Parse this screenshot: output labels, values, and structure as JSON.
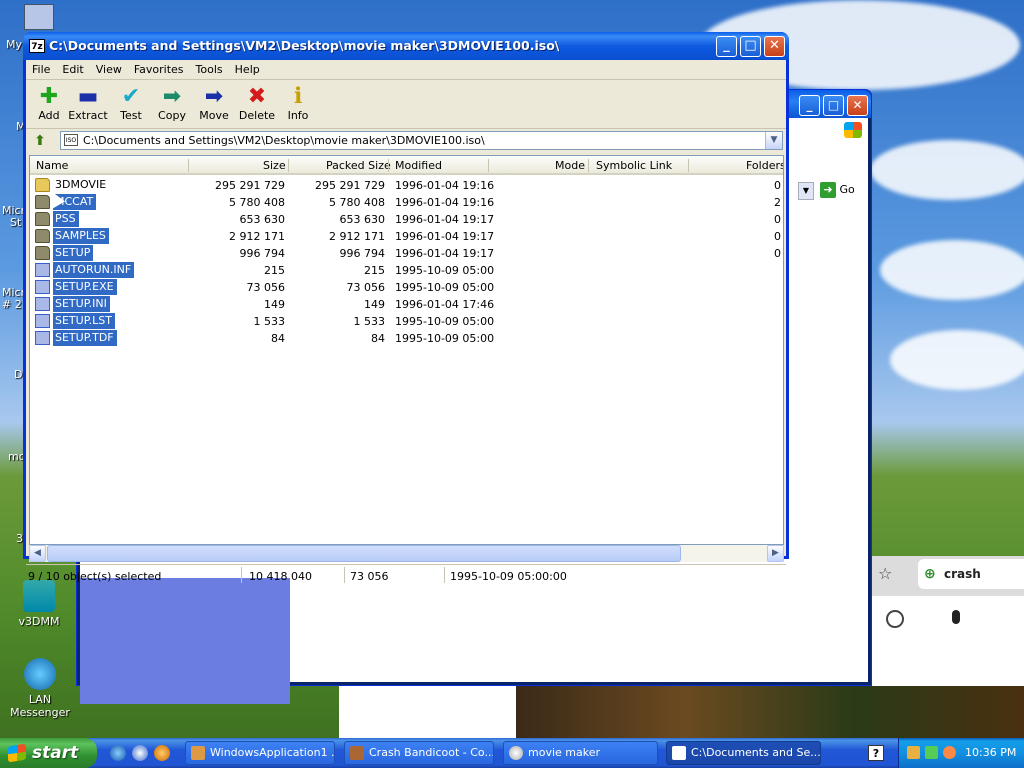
{
  "window": {
    "title": "C:\\Documents and Settings\\VM2\\Desktop\\movie maker\\3DMOVIE100.iso\\",
    "app_icon_text": "7z"
  },
  "menu": [
    "File",
    "Edit",
    "View",
    "Favorites",
    "Tools",
    "Help"
  ],
  "toolbar": [
    {
      "label": "Add",
      "icon": "plus-icon",
      "color": "#1ea51e",
      "glyph": "✚"
    },
    {
      "label": "Extract",
      "icon": "minus-icon",
      "color": "#1a2fa8",
      "glyph": "▬"
    },
    {
      "label": "Test",
      "icon": "check-icon",
      "color": "#19a9c9",
      "glyph": "✔"
    },
    {
      "label": "Copy",
      "icon": "copy-arrow-icon",
      "color": "#1d8a6a",
      "glyph": "➡"
    },
    {
      "label": "Move",
      "icon": "move-arrow-icon",
      "color": "#1a2fa8",
      "glyph": "➡"
    },
    {
      "label": "Delete",
      "icon": "delete-x-icon",
      "color": "#d41a1a",
      "glyph": "✖"
    },
    {
      "label": "Info",
      "icon": "info-icon",
      "color": "#c8a000",
      "glyph": "ℹ"
    }
  ],
  "address": {
    "path": "C:\\Documents and Settings\\VM2\\Desktop\\movie maker\\3DMOVIE100.iso\\",
    "icon_text": "ISO"
  },
  "columns": {
    "name": "Name",
    "size": "Size",
    "packed": "Packed Size",
    "modified": "Modified",
    "mode": "Mode",
    "symlink": "Symbolic Link",
    "folders": "Folders"
  },
  "files": [
    {
      "name": "3DMOVIE",
      "type": "folder",
      "size": "295 291 729",
      "packed": "295 291 729",
      "modified": "1996-01-04 19:16",
      "folders": "0",
      "selected": false
    },
    {
      "name": "MCCAT",
      "type": "folder",
      "size": "5 780 408",
      "packed": "5 780 408",
      "modified": "1996-01-04 19:16",
      "folders": "2",
      "selected": true
    },
    {
      "name": "PSS",
      "type": "folder",
      "size": "653 630",
      "packed": "653 630",
      "modified": "1996-01-04 19:17",
      "folders": "0",
      "selected": true
    },
    {
      "name": "SAMPLES",
      "type": "folder",
      "size": "2 912 171",
      "packed": "2 912 171",
      "modified": "1996-01-04 19:17",
      "folders": "0",
      "selected": true
    },
    {
      "name": "SETUP",
      "type": "folder",
      "size": "996 794",
      "packed": "996 794",
      "modified": "1996-01-04 19:17",
      "folders": "0",
      "selected": true
    },
    {
      "name": "AUTORUN.INF",
      "type": "file",
      "size": "215",
      "packed": "215",
      "modified": "1995-10-09 05:00",
      "folders": "",
      "selected": true
    },
    {
      "name": "SETUP.EXE",
      "type": "file",
      "size": "73 056",
      "packed": "73 056",
      "modified": "1995-10-09 05:00",
      "folders": "",
      "selected": true
    },
    {
      "name": "SETUP.INI",
      "type": "file",
      "size": "149",
      "packed": "149",
      "modified": "1996-01-04 17:46",
      "folders": "",
      "selected": true
    },
    {
      "name": "SETUP.LST",
      "type": "file",
      "size": "1 533",
      "packed": "1 533",
      "modified": "1995-10-09 05:00",
      "folders": "",
      "selected": true
    },
    {
      "name": "SETUP.TDF",
      "type": "file",
      "size": "84",
      "packed": "84",
      "modified": "1995-10-09 05:00",
      "folders": "",
      "selected": true
    }
  ],
  "status": {
    "selection": "9 / 10 object(s) selected",
    "total_size": "10 418 040",
    "item_size": "73 056",
    "item_date": "1995-10-09 05:00:00"
  },
  "desktop_icons": [
    {
      "label": "v3DMM"
    },
    {
      "label": "LAN Messenger"
    }
  ],
  "desktop_partial_labels": [
    "My",
    "M",
    "Micr",
    "St",
    "Micr",
    "# 2",
    "D",
    "mo",
    "3"
  ],
  "background_browser": {
    "go_label": "Go",
    "tab_label": "crash bandic"
  },
  "taskbar": {
    "start_label": "start",
    "tasks": [
      {
        "label": "WindowsApplication1 ...",
        "active": false
      },
      {
        "label": "Crash Bandicoot - Co...",
        "active": false
      },
      {
        "label": "movie maker",
        "active": false
      },
      {
        "label": "C:\\Documents and Se...",
        "active": true
      }
    ],
    "clock": "10:36 PM",
    "help_glyph": "?"
  }
}
